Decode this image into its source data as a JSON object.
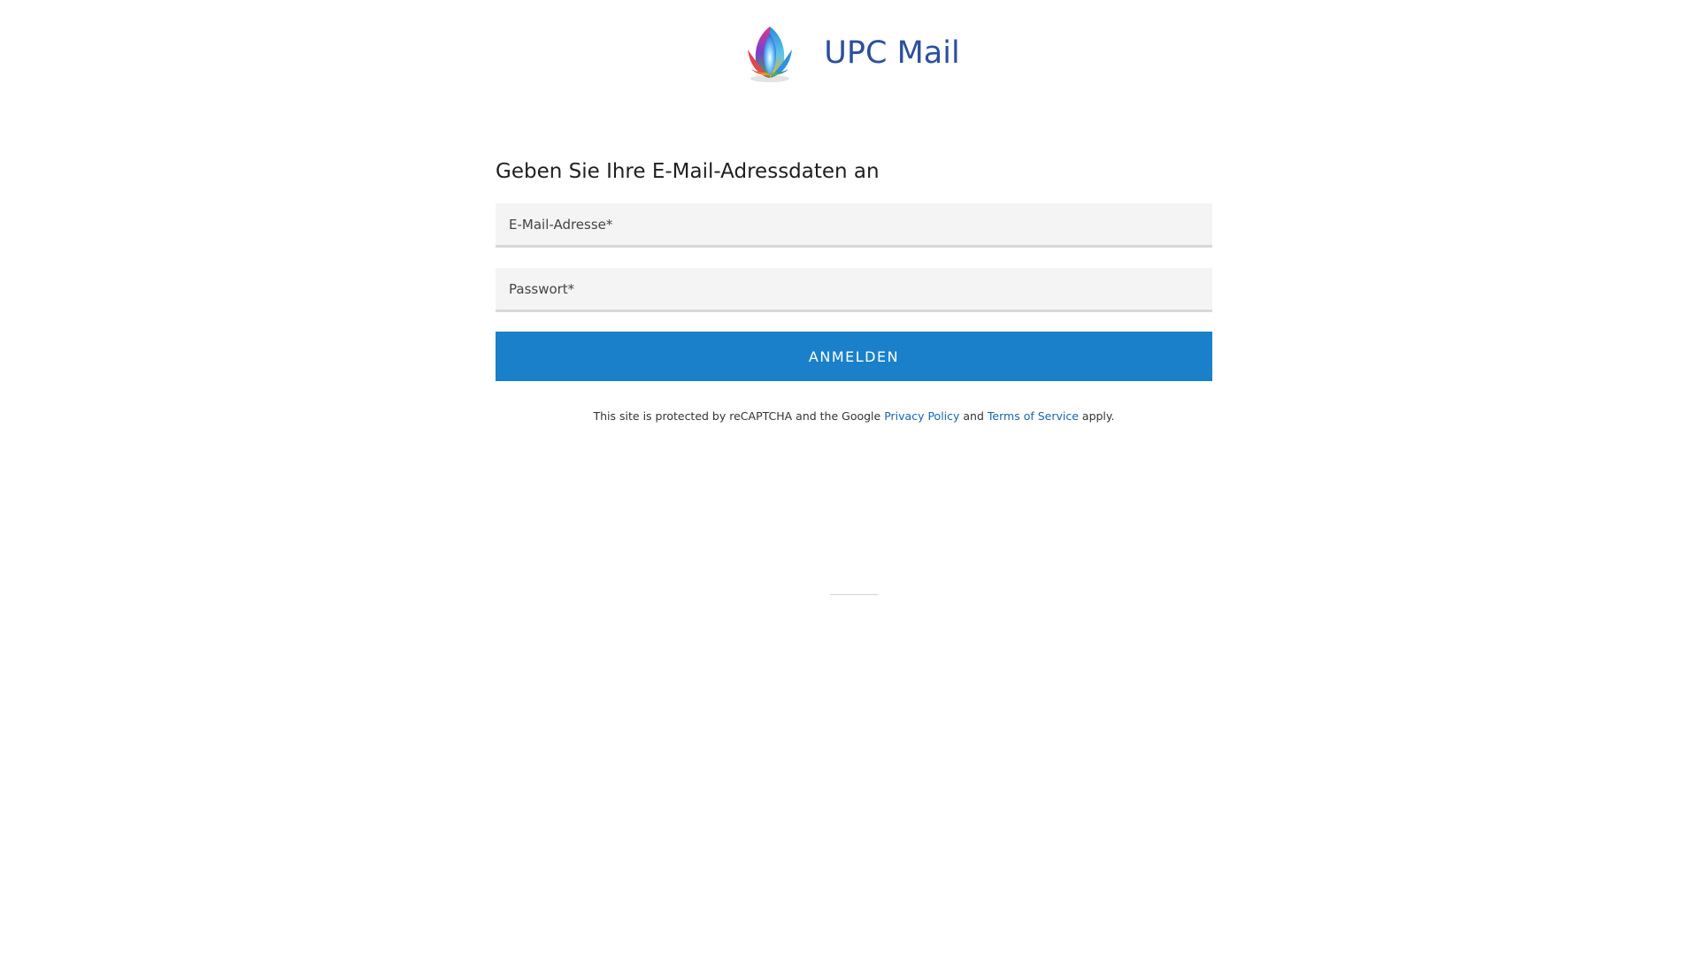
{
  "header": {
    "brand": "UPC Mail",
    "logo_icon": "upc-lotus-logo-icon"
  },
  "form": {
    "heading": "Geben Sie Ihre E-Mail-Adressdaten an",
    "email_placeholder": "E-Mail-Adresse*",
    "email_value": "",
    "password_placeholder": "Passwort*",
    "password_value": "",
    "login_label": "ANMELDEN"
  },
  "recaptcha": {
    "prefix": "This site is protected by reCAPTCHA and the Google",
    "privacy_link": "Privacy Policy",
    "and": "and",
    "terms_link": "Terms of Service",
    "suffix": "apply."
  },
  "colors": {
    "brand": "#2c4f9e",
    "button": "#1a80c9",
    "link": "#1565b0",
    "field_bg": "#f4f4f4"
  }
}
